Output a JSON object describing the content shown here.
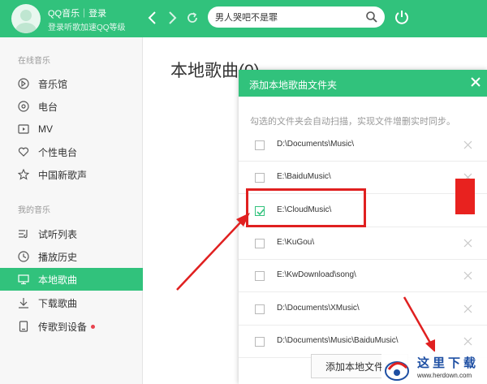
{
  "header": {
    "app_login_line": "QQ音乐｜登录",
    "login_prompt": "登录听歌加速QQ等级",
    "search_value": "男人哭吧不是罪"
  },
  "sidebar": {
    "online_title": "在线音乐",
    "online_items": [
      {
        "label": "音乐馆",
        "icon": "music-hall-icon"
      },
      {
        "label": "电台",
        "icon": "radio-icon"
      },
      {
        "label": "MV",
        "icon": "mv-icon"
      },
      {
        "label": "个性电台",
        "icon": "heart-radio-icon"
      },
      {
        "label": "中国新歌声",
        "icon": "star-icon"
      }
    ],
    "my_title": "我的音乐",
    "my_items": [
      {
        "label": "试听列表",
        "icon": "playlist-icon"
      },
      {
        "label": "播放历史",
        "icon": "history-clock-icon"
      },
      {
        "label": "本地歌曲",
        "icon": "monitor-icon",
        "active": true
      },
      {
        "label": "下载歌曲",
        "icon": "download-icon"
      },
      {
        "label": "传歌到设备",
        "icon": "device-icon",
        "badge": "red-dot"
      }
    ]
  },
  "main": {
    "title": "本地歌曲(0)"
  },
  "dialog": {
    "title": "添加本地歌曲文件夹",
    "description": "勾选的文件夹会自动扫描，实现文件增删实时同步。",
    "folders": [
      {
        "path": "D:\\Documents\\Music\\",
        "checked": false
      },
      {
        "path": "E:\\BaiduMusic\\",
        "checked": false
      },
      {
        "path": "E:\\CloudMusic\\",
        "checked": true
      },
      {
        "path": "E:\\KuGou\\",
        "checked": false
      },
      {
        "path": "E:\\KwDownload\\song\\",
        "checked": false
      },
      {
        "path": "D:\\Documents\\XMusic\\",
        "checked": false
      },
      {
        "path": "D:\\Documents\\Music\\BaiduMusic\\",
        "checked": false
      }
    ],
    "button_label": "添加本地文件夹"
  },
  "watermark": {
    "name": "这里下载",
    "url": "www.herdown.com"
  },
  "colors": {
    "brand_green": "#31c27c",
    "annotation_red": "#e02020",
    "badge_red": "#e8434e"
  }
}
